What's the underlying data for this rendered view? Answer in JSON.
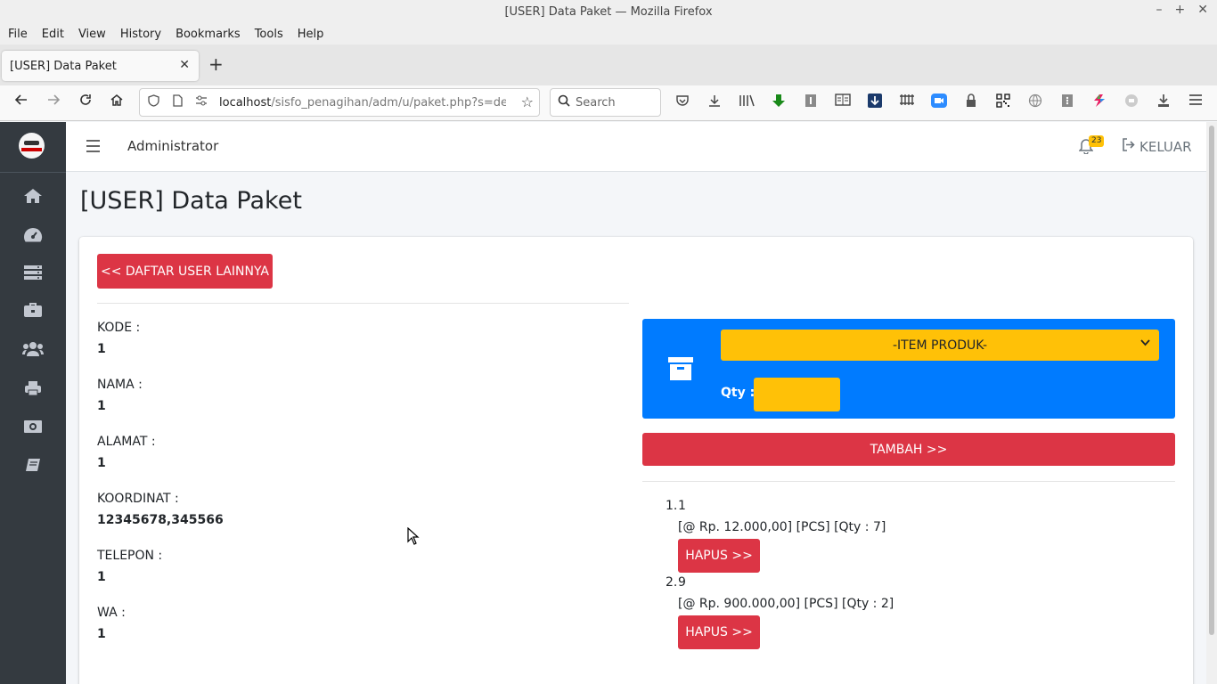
{
  "window": {
    "title": "[USER] Data Paket — Mozilla Firefox",
    "minimize": "–",
    "maximize": "+",
    "close": "✕"
  },
  "menubar": [
    "File",
    "Edit",
    "View",
    "History",
    "Bookmarks",
    "Tools",
    "Help"
  ],
  "tab": {
    "label": "[USER] Data Paket",
    "close": "✕",
    "new_tab": "+"
  },
  "url": {
    "host": "localhost",
    "path": "/sisfo_penagihan/adm/u/paket.php?s=detail&"
  },
  "search": {
    "placeholder": "Search"
  },
  "topnav": {
    "title": "Administrator",
    "notification_count": "23",
    "logout_label": "KELUAR"
  },
  "page": {
    "title": "[USER] Data Paket",
    "back_button": "<< DAFTAR USER LAINNYA"
  },
  "fields": [
    {
      "label": "KODE :",
      "value": "1"
    },
    {
      "label": "NAMA :",
      "value": "1"
    },
    {
      "label": "ALAMAT :",
      "value": "1"
    },
    {
      "label": "KOORDINAT :",
      "value": "12345678,345566"
    },
    {
      "label": "TELEPON :",
      "value": "1"
    },
    {
      "label": "WA :",
      "value": "1"
    }
  ],
  "form": {
    "select_value": "-ITEM PRODUK-",
    "qty_label": "Qty :",
    "qty_value": "",
    "add_button": "TAMBAH >>"
  },
  "items": [
    {
      "number": "1.",
      "name": "1",
      "detail": "[@ Rp. 12.000,00] [PCS] [Qty : 7]",
      "delete_label": "HAPUS >>"
    },
    {
      "number": "2.",
      "name": "9",
      "detail": "[@ Rp. 900.000,00] [PCS] [Qty : 2]",
      "delete_label": "HAPUS >>"
    }
  ],
  "colors": {
    "sidebar": "#343a40",
    "danger": "#dc3545",
    "primary": "#007bff",
    "warning": "#ffc107"
  },
  "sidebar_icons": [
    "home-icon",
    "dashboard-icon",
    "server-icon",
    "briefcase-icon",
    "users-icon",
    "print-icon",
    "money-icon",
    "book-icon"
  ]
}
